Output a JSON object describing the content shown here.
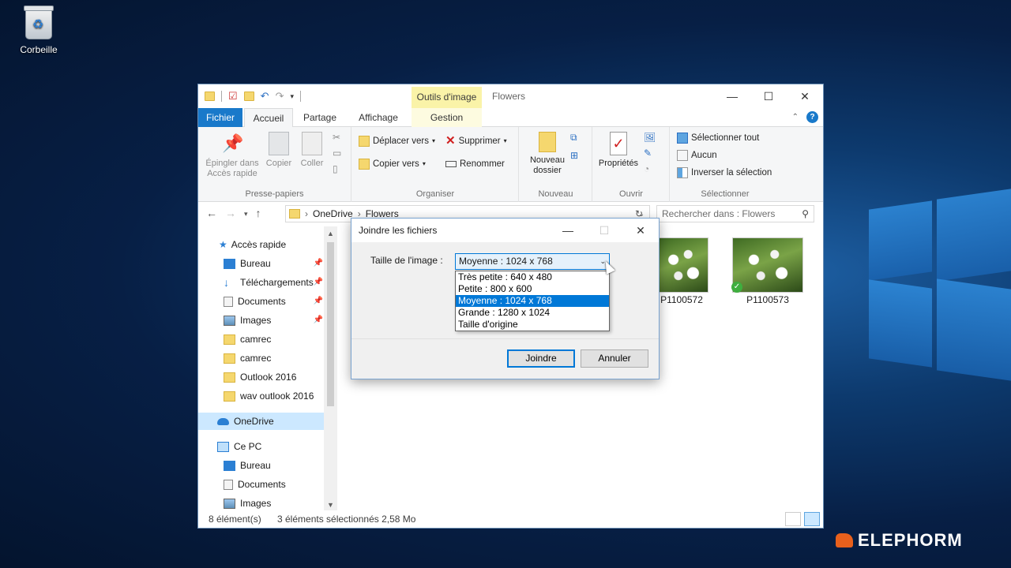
{
  "desktop": {
    "recycle_bin_label": "Corbeille",
    "brand": "ELEPHORM"
  },
  "explorer": {
    "title": "Flowers",
    "context_tab_header": "Outils d'image",
    "tabs": {
      "file": "Fichier",
      "home": "Accueil",
      "share": "Partage",
      "view": "Affichage",
      "manage": "Gestion"
    },
    "ribbon": {
      "pin_quick_access": "Épingler dans Accès rapide",
      "copy": "Copier",
      "paste": "Coller",
      "clipboard_group": "Presse-papiers",
      "move_to": "Déplacer vers",
      "copy_to": "Copier vers",
      "delete": "Supprimer",
      "rename": "Renommer",
      "organize_group": "Organiser",
      "new_folder": "Nouveau dossier",
      "new_group": "Nouveau",
      "properties": "Propriétés",
      "open_group": "Ouvrir",
      "select_all": "Sélectionner tout",
      "select_none": "Aucun",
      "invert_selection": "Inverser la sélection",
      "select_group": "Sélectionner"
    },
    "address": {
      "path": [
        "OneDrive",
        "Flowers"
      ],
      "search_placeholder": "Rechercher dans : Flowers"
    },
    "nav": {
      "quick_access": "Accès rapide",
      "items": [
        "Bureau",
        "Téléchargements",
        "Documents",
        "Images",
        "camrec",
        "camrec",
        "Outlook 2016",
        "wav outlook 2016"
      ],
      "onedrive": "OneDrive",
      "this_pc": "Ce PC",
      "pc_items": [
        "Bureau",
        "Documents",
        "Images"
      ]
    },
    "files": [
      {
        "name": "P1100572"
      },
      {
        "name": "P1100573"
      }
    ],
    "status": {
      "count": "8 élément(s)",
      "selection": "3 éléments sélectionnés  2,58 Mo"
    }
  },
  "dialog": {
    "title": "Joindre les fichiers",
    "size_label": "Taille de l'image :",
    "selected": "Moyenne : 1024 x 768",
    "options": [
      "Très petite : 640 x 480",
      "Petite : 800 x 600",
      "Moyenne : 1024 x 768",
      "Grande : 1280 x 1024",
      "Taille d'origine"
    ],
    "ok_label": "Joindre",
    "cancel_label": "Annuler"
  }
}
